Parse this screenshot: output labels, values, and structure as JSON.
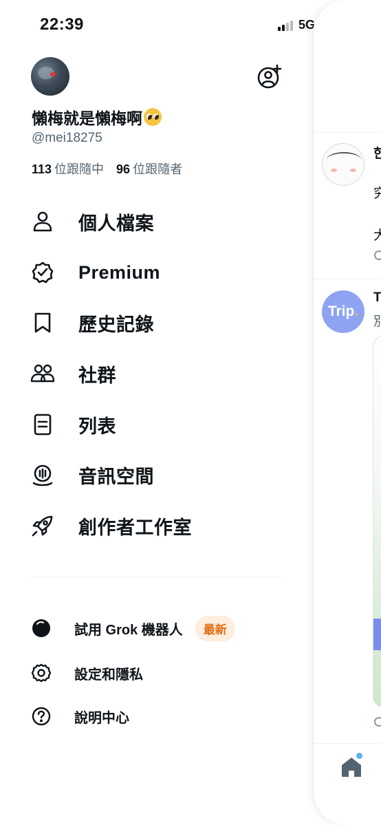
{
  "status_bar": {
    "time": "22:39",
    "network": "5G"
  },
  "profile": {
    "display_name": "懶梅就是懶梅啊",
    "handle": "@mei18275",
    "following_count": "113",
    "following_label": "位跟隨中",
    "followers_count": "96",
    "followers_label": "位跟隨者"
  },
  "menu": {
    "profile": "個人檔案",
    "premium": "Premium",
    "bookmarks": "歷史記錄",
    "communities": "社群",
    "lists": "列表",
    "spaces": "音訊空間",
    "creator_studio": "創作者工作室"
  },
  "secondary": {
    "grok": "試用 Grok 機器人",
    "grok_badge": "最新",
    "settings": "設定和隱私",
    "help": "說明中心"
  },
  "peek": {
    "trip_logo": "Trip",
    "snippet_1": "한",
    "snippet_2": "究",
    "snippet_3": "大",
    "snippet_4": "T",
    "snippet_5": "別"
  },
  "colors": {
    "text": "#0f1419",
    "secondary_text": "#536471",
    "badge_text": "#e26f14",
    "badge_bg": "#fdeee0",
    "trip_brand": "#8ea4f2"
  },
  "icons": [
    "person-icon",
    "verified-badge-icon",
    "bookmark-icon",
    "communities-icon",
    "list-icon",
    "spaces-icon",
    "rocket-icon",
    "grok-icon",
    "gear-icon",
    "help-icon",
    "add-account-icon",
    "home-icon"
  ]
}
